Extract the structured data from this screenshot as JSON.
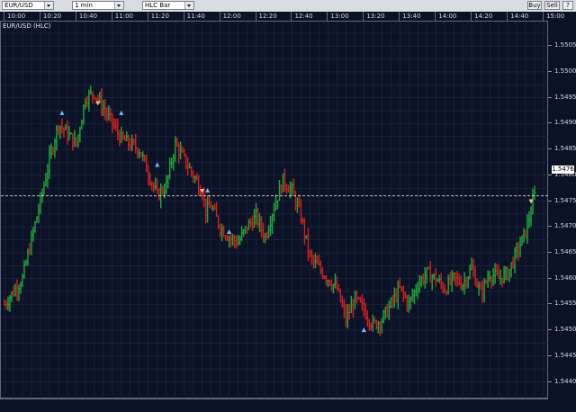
{
  "toolbar": {
    "symbol_select": "EUR/USD",
    "interval_select": "1 min",
    "chart_type_select": "HLC Bar",
    "buy_label": "Buy",
    "sell_label": "Sell",
    "help_label": "?"
  },
  "chart_title": "EUR/USD (HLC)",
  "colors": {
    "background": "#0b1226",
    "grid": "#1f2a47",
    "up_bar": "#1faa3a",
    "down_bar": "#d42020",
    "marker_up": "#7fb8ff",
    "marker_down": "#f0c080",
    "price_line": "#ffffff"
  },
  "time_labels": [
    "10:00",
    "10:20",
    "10:40",
    "11:00",
    "11:20",
    "11:40",
    "12:00",
    "12:20",
    "12:40",
    "13:00",
    "13:20",
    "13:40",
    "14:00",
    "14:20",
    "14:40",
    "15:00"
  ],
  "price_labels": [
    "1.5505",
    "1.5500",
    "1.5495",
    "1.5490",
    "1.5485",
    "1.5480",
    "1.5475",
    "1.5470",
    "1.5465",
    "1.5460",
    "1.5455",
    "1.5450",
    "1.5445",
    "1.5440"
  ],
  "last_price": "1.5476",
  "chart_data": {
    "type": "line",
    "title": "EUR/USD (HLC)",
    "xlabel": "",
    "ylabel": "",
    "x_range": [
      "10:00",
      "15:00"
    ],
    "ylim": [
      1.5438,
      1.5508
    ],
    "grid": true,
    "last_price": 1.5476,
    "series": [
      {
        "name": "EUR/USD",
        "x": [
          "10:00",
          "10:10",
          "10:20",
          "10:25",
          "10:30",
          "10:40",
          "10:45",
          "10:50",
          "11:00",
          "11:05",
          "11:15",
          "11:25",
          "11:30",
          "11:35",
          "11:45",
          "11:50",
          "11:52",
          "11:55",
          "12:00",
          "12:05",
          "12:10",
          "12:15",
          "12:20",
          "12:25",
          "12:30",
          "12:35",
          "12:40",
          "12:45",
          "12:50",
          "12:55",
          "13:00",
          "13:05",
          "13:10",
          "13:15",
          "13:20",
          "13:25",
          "13:30",
          "13:40",
          "13:45",
          "13:50",
          "13:55",
          "14:00",
          "14:05",
          "14:10",
          "14:15",
          "14:20",
          "14:25",
          "14:30",
          "14:35",
          "14:40",
          "14:45",
          "14:50",
          "14:55"
        ],
        "values": [
          1.5455,
          1.546,
          1.5475,
          1.5483,
          1.549,
          1.5486,
          1.5495,
          1.5496,
          1.549,
          1.5487,
          1.5485,
          1.5476,
          1.5478,
          1.5486,
          1.548,
          1.5477,
          1.5473,
          1.5474,
          1.547,
          1.5468,
          1.5467,
          1.547,
          1.5472,
          1.5468,
          1.5474,
          1.5479,
          1.5477,
          1.5472,
          1.5464,
          1.5462,
          1.546,
          1.5458,
          1.5452,
          1.5456,
          1.5454,
          1.5451,
          1.5452,
          1.5458,
          1.5455,
          1.5459,
          1.5461,
          1.546,
          1.5458,
          1.546,
          1.5459,
          1.5462,
          1.5457,
          1.5461,
          1.546,
          1.5461,
          1.5465,
          1.5469,
          1.5476
        ]
      }
    ],
    "markers": [
      {
        "x": "10:32",
        "value": 1.5492,
        "direction": "up"
      },
      {
        "x": "10:52",
        "value": 1.5494,
        "direction": "down"
      },
      {
        "x": "11:05",
        "value": 1.5492,
        "direction": "up"
      },
      {
        "x": "11:25",
        "value": 1.5482,
        "direction": "up"
      },
      {
        "x": "11:50",
        "value": 1.5477,
        "direction": "down"
      },
      {
        "x": "11:53",
        "value": 1.5477,
        "direction": "up"
      },
      {
        "x": "12:05",
        "value": 1.5469,
        "direction": "up"
      },
      {
        "x": "13:20",
        "value": 1.545,
        "direction": "up"
      },
      {
        "x": "14:53",
        "value": 1.5475,
        "direction": "down"
      }
    ]
  }
}
